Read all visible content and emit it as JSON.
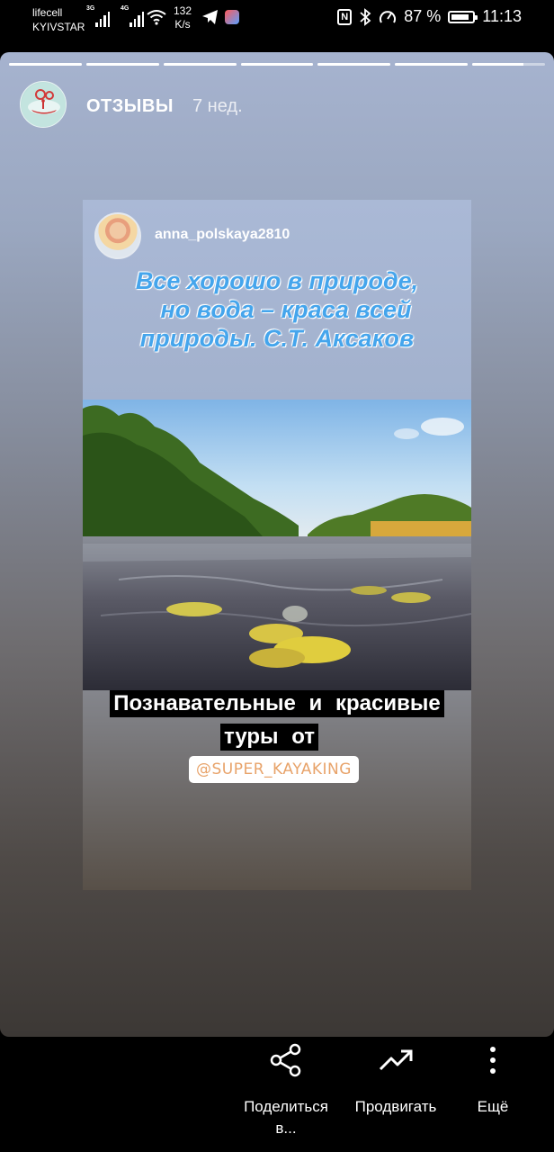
{
  "status_bar": {
    "carrier_1": "lifecell",
    "carrier_2": "KYIVSTAR",
    "net_1": "3G",
    "net_2": "4G",
    "speed_value": "132",
    "speed_unit": "K/s",
    "battery": "87 %",
    "time": "11:13",
    "battery_level": 0.87
  },
  "story": {
    "segments_total": 7,
    "segments_completed": 6,
    "current_segment_progress": 0.7,
    "account_name": "ОТЗЫВЫ",
    "time_ago": "7 нед."
  },
  "post": {
    "username": "anna_polskaya2810",
    "quote_line_1": "Все хорошо в природе,",
    "quote_line_2": "но вода – краса всей",
    "quote_line_3": "природы. С.Т. Аксаков",
    "caption_line_1": "Познавательные и красивые",
    "caption_line_2": "туры от",
    "mention": "@SUPER_KAYAKING"
  },
  "actions": {
    "share_label_1": "Поделиться",
    "share_label_2": "в...",
    "promote_label": "Продвигать",
    "more_label": "Ещё"
  },
  "colors": {
    "quote": "#45a5ec",
    "mention": "#e8a36a"
  }
}
